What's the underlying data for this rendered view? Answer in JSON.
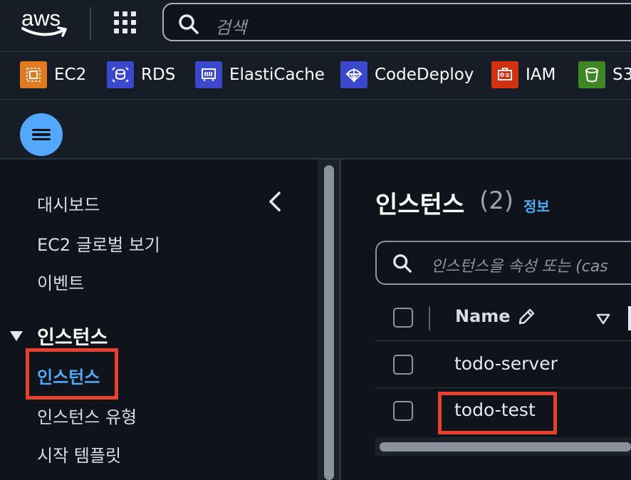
{
  "topbar": {
    "logo_text": "aws",
    "search_placeholder": "검색",
    "icons": {
      "apps": "grid-icon",
      "search": "search-icon"
    }
  },
  "favorites": [
    {
      "label": "EC2",
      "icon": "ec2-service-icon",
      "color": "#e07b21"
    },
    {
      "label": "RDS",
      "icon": "rds-service-icon",
      "color": "#3b48cc"
    },
    {
      "label": "ElastiCache",
      "icon": "elasticache-service-icon",
      "color": "#3b48cc"
    },
    {
      "label": "CodeDeploy",
      "icon": "codedeploy-service-icon",
      "color": "#3b48cc"
    },
    {
      "label": "IAM",
      "icon": "iam-service-icon",
      "color": "#d13212"
    },
    {
      "label": "S3",
      "icon": "s3-service-icon",
      "color": "#3f8624"
    }
  ],
  "sidebar": {
    "items": [
      {
        "label": "대시보드"
      },
      {
        "label": "EC2 글로벌 보기"
      },
      {
        "label": "이벤트"
      }
    ],
    "section": {
      "label": "인스턴스",
      "items": [
        {
          "label": "인스턴스",
          "active": true
        },
        {
          "label": "인스턴스 유형"
        },
        {
          "label": "시작 템플릿"
        }
      ]
    }
  },
  "main": {
    "title": "인스턴스",
    "count": "(2)",
    "info_link": "정보",
    "filter_placeholder": "인스턴스을 속성 또는 (cas",
    "table": {
      "columns": [
        {
          "label": "Name"
        }
      ],
      "rows": [
        {
          "name": "todo-server"
        },
        {
          "name": "todo-test"
        }
      ]
    }
  },
  "colors": {
    "accent": "#53a9ff",
    "highlight_box": "#e8402d",
    "background": "#0f141a",
    "header_bg": "#161d26"
  }
}
